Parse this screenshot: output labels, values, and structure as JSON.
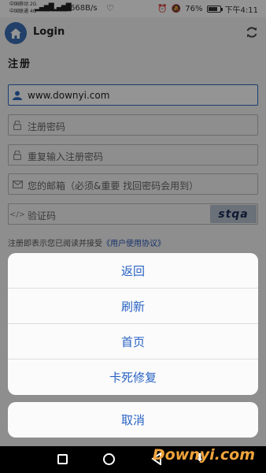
{
  "status_bar": {
    "carrier_1": "中国移动",
    "carrier_1_tag": "2G",
    "carrier_2": "中国联通",
    "carrier_2_tag": "4G",
    "net_speed": "668B/s",
    "battery": "76%",
    "time": "下午4:11"
  },
  "header": {
    "home_icon": "home-icon",
    "title": "Login",
    "refresh_icon": "refresh-icon"
  },
  "form": {
    "section_title": "注册",
    "username_value": "www.downyi.com",
    "password_placeholder": "注册密码",
    "repeat_password_placeholder": "重复输入注册密码",
    "email_placeholder": "您的邮箱（必须&重要  找回密码会用到）",
    "captcha_placeholder": "验证码",
    "captcha_text": "stqa",
    "agreement_prefix": "注册即表示您已阅读并接受",
    "agreement_link": "《用户使用协议》"
  },
  "action_sheet": {
    "items": [
      "返回",
      "刷新",
      "首页",
      "卡死修复"
    ],
    "cancel": "取消"
  },
  "watermark": "Downyi.com",
  "colors": {
    "accent": "#2a63c4",
    "home_button": "#3b6fb5",
    "watermark": "#f1a43c"
  }
}
